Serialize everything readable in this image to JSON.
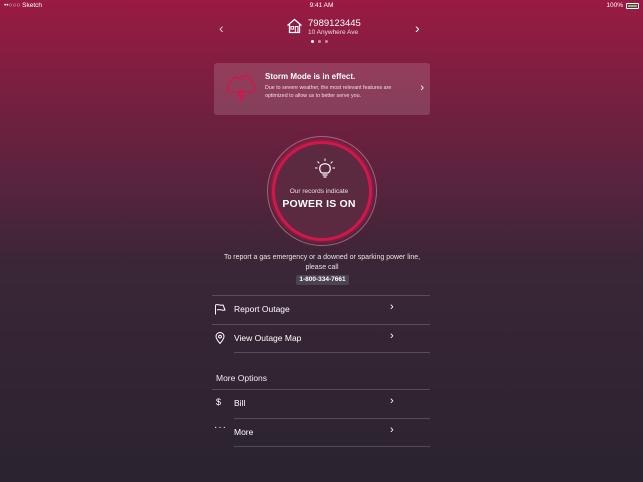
{
  "status_bar": {
    "carrier": "••○○○ Sketch",
    "time": "9:41 AM",
    "battery": "100%"
  },
  "account": {
    "number": "7989123445",
    "address": "10 Anywhere Ave",
    "page_count": 3,
    "active_page": 1
  },
  "storm": {
    "title": "Storm Mode is in effect.",
    "message": "Due to severe weather, the most relevant features are optimized to allow us to better serve you."
  },
  "power": {
    "subtitle": "Our records indicate",
    "status": "POWER IS ON"
  },
  "emergency": {
    "text": "To report a gas emergency or a downed or sparking power line, please call",
    "phone": "1-800-334-7661"
  },
  "actions": [
    {
      "label": "Report Outage",
      "icon": "pin-flag-icon"
    },
    {
      "label": "View Outage Map",
      "icon": "map-pin-icon"
    }
  ],
  "more_options": {
    "heading": "More Options",
    "items": [
      {
        "label": "Bill",
        "icon": "dollar-icon",
        "glyph": "$"
      },
      {
        "label": "More",
        "icon": "ellipsis-icon",
        "glyph": "···"
      }
    ]
  },
  "glyphs": {
    "prev": "‹",
    "next": "›",
    "chevron": "›"
  },
  "colors": {
    "accent": "#d0174c",
    "top_gradient": "#9a1a43",
    "bottom_gradient": "#2b2330"
  }
}
